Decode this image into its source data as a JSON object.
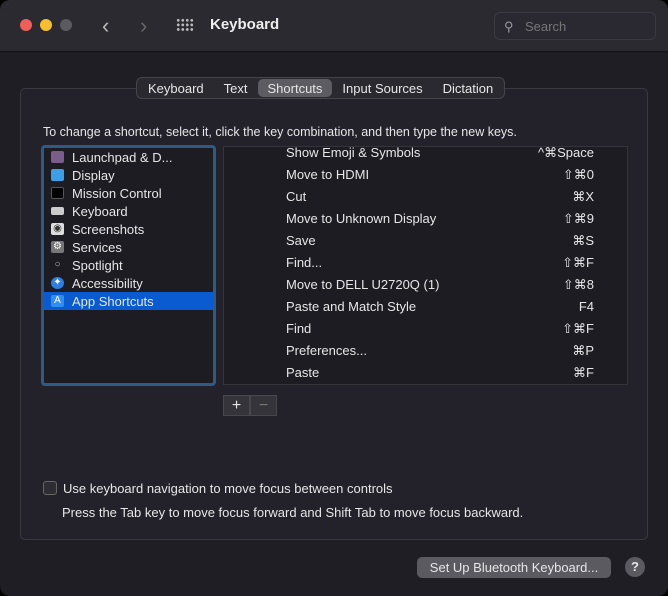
{
  "window": {
    "title": "Keyboard",
    "search_placeholder": "Search"
  },
  "tabs": [
    {
      "label": "Keyboard"
    },
    {
      "label": "Text"
    },
    {
      "label": "Shortcuts",
      "active": true
    },
    {
      "label": "Input Sources"
    },
    {
      "label": "Dictation"
    }
  ],
  "instruction": "To change a shortcut, select it, click the key combination, and then type the new keys.",
  "categories": [
    {
      "label": "Launchpad & D...",
      "icon": "launchpad-icon"
    },
    {
      "label": "Display",
      "icon": "display-icon"
    },
    {
      "label": "Mission Control",
      "icon": "mission-control-icon"
    },
    {
      "label": "Keyboard",
      "icon": "keyboard-icon"
    },
    {
      "label": "Screenshots",
      "icon": "screenshot-icon"
    },
    {
      "label": "Services",
      "icon": "gear-icon"
    },
    {
      "label": "Spotlight",
      "icon": "search-icon"
    },
    {
      "label": "Accessibility",
      "icon": "accessibility-icon"
    },
    {
      "label": "App Shortcuts",
      "icon": "app-store-icon",
      "selected": true
    }
  ],
  "shortcuts": [
    {
      "name": "Show Emoji & Symbols",
      "keys": "^⌘Space"
    },
    {
      "name": "Move to HDMI",
      "keys": "⇧⌘0"
    },
    {
      "name": "Cut",
      "keys": "⌘X"
    },
    {
      "name": "Move to Unknown Display",
      "keys": "⇧⌘9"
    },
    {
      "name": "Save",
      "keys": "⌘S"
    },
    {
      "name": "Find...",
      "keys": "⇧⌘F"
    },
    {
      "name": "Move to DELL U2720Q (1)",
      "keys": "⇧⌘8"
    },
    {
      "name": "Paste and Match Style",
      "keys": "F4"
    },
    {
      "name": "Find",
      "keys": "⇧⌘F"
    },
    {
      "name": "Preferences...",
      "keys": "⌘P"
    },
    {
      "name": "Paste",
      "keys": "⌘F"
    }
  ],
  "add_label": "+",
  "remove_label": "−",
  "keyboard_nav": {
    "label": "Use keyboard navigation to move focus between controls",
    "checked": false,
    "hint": "Press the Tab key to move focus forward and Shift Tab to move focus backward."
  },
  "bluetooth_button": "Set Up Bluetooth Keyboard...",
  "help_label": "?",
  "colors": {
    "accent": "#0a5ad0",
    "close": "#ed5f57",
    "minimize": "#f5bf2f",
    "zoom": "#5b5a60"
  }
}
